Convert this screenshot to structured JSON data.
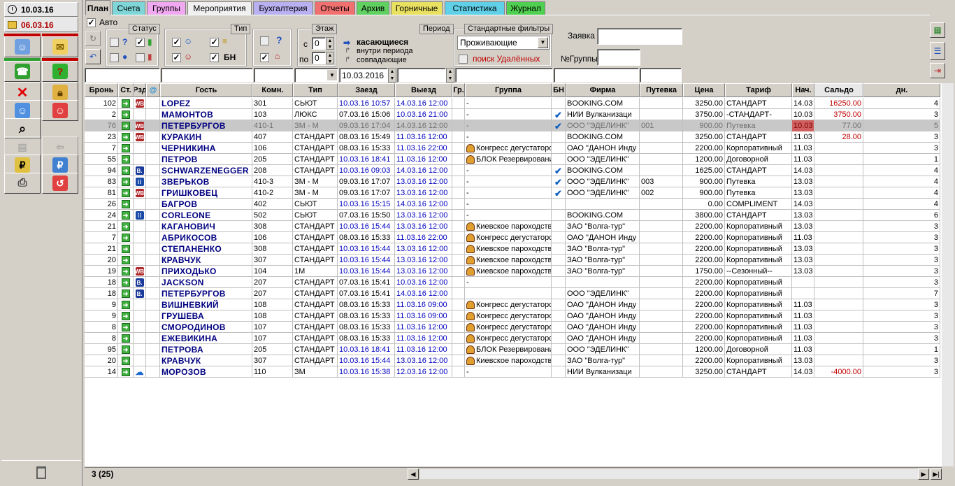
{
  "left_panel": {
    "date1": "10.03.16",
    "date2": "06.03.16"
  },
  "tabs": [
    {
      "label": "План",
      "color": "#d4d0c8",
      "active": true
    },
    {
      "label": "Счета",
      "color": "#7fd6d8"
    },
    {
      "label": "Группы",
      "color": "#f0a8f0"
    },
    {
      "label": "Мероприятия",
      "color": "#f0f0f0"
    },
    {
      "label": "Бухгалтерия",
      "color": "#b8b0f0"
    },
    {
      "label": "Отчеты",
      "color": "#f07070"
    },
    {
      "label": "Архив",
      "color": "#60d060"
    },
    {
      "label": "Горничные",
      "color": "#e8e060"
    },
    {
      "label": "Статистика",
      "color": "#60d0e8"
    },
    {
      "label": "Журнал",
      "color": "#50d050"
    }
  ],
  "toolbar": {
    "auto_label": "Авто",
    "status_label": "Статус",
    "type_label": "Тип",
    "bn_label": "БН",
    "floor_label": "Этаж",
    "from_label": "с",
    "to_label": "по",
    "floor_from": "0",
    "floor_to": "0",
    "period_label": "Период",
    "period_opt1": "касающиеся",
    "period_opt2": "внутри периода",
    "period_opt3": "совпадающие",
    "std_filters_label": "Стандартные фильтры",
    "std_filter_value": "Проживающие",
    "deleted_label": "поиск Удалённых",
    "zayavka_label": "Заявка",
    "group_no_label": "№Группы",
    "date_filter": "10.03.2016"
  },
  "columns": [
    "Бронь",
    "Ст.",
    "Рзд",
    "@",
    "Гость",
    "Комн.",
    "Тип",
    "Заезд",
    "Выезд",
    "Гр.",
    "Группа",
    "БН",
    "Фирма",
    "Путевка",
    "Цена",
    "Тариф",
    "Нач.",
    "Сальдо",
    "дн."
  ],
  "rows": [
    {
      "id": "102",
      "src": "WB",
      "guest": "LOPEZ",
      "room": "301",
      "type": "СЬЮТ",
      "in": "10.03.16 10:57",
      "out": "14.03.16 12:00",
      "grp": false,
      "group": "-",
      "bn": false,
      "firm": "BOOKING.COM",
      "voucher": "",
      "price": "3250.00",
      "tariff": "СТАНДАРТ",
      "start": "14.03",
      "saldo": "16250.00",
      "days": "4",
      "in_blue": true,
      "out_blue": true,
      "saldo_red": true
    },
    {
      "id": "2",
      "src": "",
      "guest": "МАМОНТОВ",
      "room": "103",
      "type": "ЛЮКС",
      "in": "07.03.16 15:06",
      "out": "10.03.16 21:00",
      "grp": false,
      "group": "-",
      "bn": true,
      "firm": "НИИ Вулканизаци",
      "voucher": "",
      "price": "3750.00",
      "tariff": "-СТАНДАРТ-",
      "start": "10.03",
      "saldo": "3750.00",
      "days": "3",
      "in_blue": false,
      "out_blue": true,
      "saldo_red": true
    },
    {
      "id": "76",
      "src": "WB",
      "guest": "ПЕТЕРБУРГОВ",
      "room": "410-1",
      "type": "ЗМ - М",
      "in": "09.03.16 17:04",
      "out": "14.03.16 12:00",
      "grp": false,
      "group": "-",
      "bn": true,
      "firm": "ООО \"ЭДЕЛИНК\"",
      "voucher": "001",
      "price": "900.00",
      "tariff": "Путевка",
      "start": "10.03",
      "saldo": "77.00",
      "days": "5",
      "selected": true,
      "saldo_red": true
    },
    {
      "id": "23",
      "src": "WB",
      "guest": "КУРАКИН",
      "room": "407",
      "type": "СТАНДАРТ",
      "in": "08.03.16 15:49",
      "out": "11.03.16 12:00",
      "grp": false,
      "group": "-",
      "bn": false,
      "firm": "BOOKING.COM",
      "voucher": "",
      "price": "3250.00",
      "tariff": "СТАНДАРТ",
      "start": "11.03",
      "saldo": "28.00",
      "days": "3",
      "in_blue": false,
      "out_blue": true,
      "saldo_red": true
    },
    {
      "id": "7",
      "src": "",
      "guest": "ЧЕРНИКИНА",
      "room": "106",
      "type": "СТАНДАРТ",
      "in": "08.03.16 15:33",
      "out": "11.03.16 22:00",
      "grp": true,
      "group": "Конгресс дегустаторов",
      "bn": false,
      "firm": "ОАО \"ДАНОН Инду",
      "voucher": "",
      "price": "2200.00",
      "tariff": "Корпоративный",
      "start": "11.03",
      "saldo": "",
      "days": "3",
      "out_blue": true
    },
    {
      "id": "55",
      "src": "",
      "guest": "ПЕТРОВ",
      "room": "205",
      "type": "СТАНДАРТ",
      "in": "10.03.16 18:41",
      "out": "11.03.16 12:00",
      "grp": true,
      "group": "БЛОК Резервирований",
      "bn": false,
      "firm": "ООО \"ЭДЕЛИНК\"",
      "voucher": "",
      "price": "1200.00",
      "tariff": "Договорной",
      "start": "11.03",
      "saldo": "",
      "days": "1",
      "in_blue": true,
      "out_blue": true
    },
    {
      "id": "94",
      "src": "B",
      "guest": "SCHWARZENEGGER",
      "room": "208",
      "type": "СТАНДАРТ",
      "in": "10.03.16 09:03",
      "out": "14.03.16 12:00",
      "grp": false,
      "group": "-",
      "bn": true,
      "firm": "BOOKING.COM",
      "voucher": "",
      "price": "1625.00",
      "tariff": "СТАНДАРТ",
      "start": "14.03",
      "saldo": "",
      "days": "4",
      "in_blue": true,
      "out_blue": true
    },
    {
      "id": "83",
      "src": "EX",
      "guest": "ЗВЕРЬКОВ",
      "room": "410-3",
      "type": "ЗМ - М",
      "in": "09.03.16 17:07",
      "out": "13.03.16 12:00",
      "grp": false,
      "group": "-",
      "bn": true,
      "firm": "ООО \"ЭДЕЛИНК\"",
      "voucher": "003",
      "price": "900.00",
      "tariff": "Путевка",
      "start": "13.03",
      "saldo": "",
      "days": "4",
      "out_blue": true
    },
    {
      "id": "81",
      "src": "WB",
      "guest": "ГРИШКОВЕЦ",
      "room": "410-2",
      "type": "ЗМ - М",
      "in": "09.03.16 17:07",
      "out": "13.03.16 12:00",
      "grp": false,
      "group": "-",
      "bn": true,
      "firm": "ООО \"ЭДЕЛИНК\"",
      "voucher": "002",
      "price": "900.00",
      "tariff": "Путевка",
      "start": "13.03",
      "saldo": "",
      "days": "4",
      "out_blue": true
    },
    {
      "id": "26",
      "src": "",
      "guest": "БАГРОВ",
      "room": "402",
      "type": "СЬЮТ",
      "in": "10.03.16 15:15",
      "out": "14.03.16 12:00",
      "grp": false,
      "group": "-",
      "bn": false,
      "firm": "",
      "voucher": "",
      "price": "0.00",
      "tariff": "COMPLIMENT",
      "start": "14.03",
      "saldo": "",
      "days": "4",
      "in_blue": true,
      "out_blue": true
    },
    {
      "id": "24",
      "src": "EX",
      "guest": "CORLEONE",
      "room": "502",
      "type": "СЬЮТ",
      "in": "07.03.16 15:50",
      "out": "13.03.16 12:00",
      "grp": false,
      "group": "-",
      "bn": false,
      "firm": "BOOKING.COM",
      "voucher": "",
      "price": "3800.00",
      "tariff": "СТАНДАРТ",
      "start": "13.03",
      "saldo": "",
      "days": "6",
      "out_blue": true
    },
    {
      "id": "21",
      "src": "",
      "guest": "КАГАНОВИЧ",
      "room": "308",
      "type": "СТАНДАРТ",
      "in": "10.03.16 15:44",
      "out": "13.03.16 12:00",
      "grp": true,
      "group": "Киевское пароходство",
      "bn": false,
      "firm": "ЗАО \"Волга-тур\"",
      "voucher": "",
      "price": "2200.00",
      "tariff": "Корпоративный",
      "start": "13.03",
      "saldo": "",
      "days": "3",
      "in_blue": true,
      "out_blue": true
    },
    {
      "id": "7",
      "src": "",
      "guest": "АБРИКОСОВ",
      "room": "106",
      "type": "СТАНДАРТ",
      "in": "08.03.16 15:33",
      "out": "11.03.16 22:00",
      "grp": true,
      "group": "Конгресс дегустаторов",
      "bn": false,
      "firm": "ОАО \"ДАНОН Инду",
      "voucher": "",
      "price": "2200.00",
      "tariff": "Корпоративный",
      "start": "11.03",
      "saldo": "",
      "days": "3",
      "out_blue": true
    },
    {
      "id": "21",
      "src": "",
      "guest": "СТЕПАНЕНКО",
      "room": "308",
      "type": "СТАНДАРТ",
      "in": "10.03.16 15:44",
      "out": "13.03.16 12:00",
      "grp": true,
      "group": "Киевское пароходство",
      "bn": false,
      "firm": "ЗАО \"Волга-тур\"",
      "voucher": "",
      "price": "2200.00",
      "tariff": "Корпоративный",
      "start": "13.03",
      "saldo": "",
      "days": "3",
      "in_blue": true,
      "out_blue": true
    },
    {
      "id": "20",
      "src": "",
      "guest": "КРАВЧУК",
      "room": "307",
      "type": "СТАНДАРТ",
      "in": "10.03.16 15:44",
      "out": "13.03.16 12:00",
      "grp": true,
      "group": "Киевское пароходство",
      "bn": false,
      "firm": "ЗАО \"Волга-тур\"",
      "voucher": "",
      "price": "2200.00",
      "tariff": "Корпоративный",
      "start": "13.03",
      "saldo": "",
      "days": "3",
      "in_blue": true,
      "out_blue": true
    },
    {
      "id": "19",
      "src": "WB",
      "guest": "ПРИХОДЬКО",
      "room": "104",
      "type": "1М",
      "in": "10.03.16 15:44",
      "out": "13.03.16 12:00",
      "grp": true,
      "group": "Киевское пароходство",
      "bn": false,
      "firm": "ЗАО \"Волга-тур\"",
      "voucher": "",
      "price": "1750.00",
      "tariff": "--Сезонный--",
      "start": "13.03",
      "saldo": "",
      "days": "3",
      "in_blue": true,
      "out_blue": true
    },
    {
      "id": "18",
      "src": "B",
      "guest": "JACKSON",
      "room": "207",
      "type": "СТАНДАРТ",
      "in": "07.03.16 15:41",
      "out": "10.03.16 12:00",
      "grp": false,
      "group": "-",
      "bn": false,
      "firm": "",
      "voucher": "",
      "price": "2200.00",
      "tariff": "Корпоративный",
      "start": "",
      "saldo": "",
      "days": "3",
      "out_blue": true
    },
    {
      "id": "18",
      "src": "B",
      "guest": "ПЕТЕРБУРГОВ",
      "room": "207",
      "type": "СТАНДАРТ",
      "in": "07.03.16 15:41",
      "out": "14.03.16 12:00",
      "grp": false,
      "group": "",
      "bn": false,
      "firm": "ООО \"ЭДЕЛИНК\"",
      "voucher": "",
      "price": "2200.00",
      "tariff": "Корпоративный",
      "start": "",
      "saldo": "",
      "days": "7",
      "out_blue": true
    },
    {
      "id": "9",
      "src": "",
      "guest": "ВИШНЕВКИЙ",
      "room": "108",
      "type": "СТАНДАРТ",
      "in": "08.03.16 15:33",
      "out": "11.03.16 09:00",
      "grp": true,
      "group": "Конгресс дегустаторов",
      "bn": false,
      "firm": "ОАО \"ДАНОН Инду",
      "voucher": "",
      "price": "2200.00",
      "tariff": "Корпоративный",
      "start": "11.03",
      "saldo": "",
      "days": "3",
      "out_blue": true
    },
    {
      "id": "9",
      "src": "",
      "guest": "ГРУШЕВА",
      "room": "108",
      "type": "СТАНДАРТ",
      "in": "08.03.16 15:33",
      "out": "11.03.16 09:00",
      "grp": true,
      "group": "Конгресс дегустаторов",
      "bn": false,
      "firm": "ОАО \"ДАНОН Инду",
      "voucher": "",
      "price": "2200.00",
      "tariff": "Корпоративный",
      "start": "11.03",
      "saldo": "",
      "days": "3",
      "out_blue": true
    },
    {
      "id": "8",
      "src": "",
      "guest": "СМОРОДИНОВ",
      "room": "107",
      "type": "СТАНДАРТ",
      "in": "08.03.16 15:33",
      "out": "11.03.16 12:00",
      "grp": true,
      "group": "Конгресс дегустаторов",
      "bn": false,
      "firm": "ОАО \"ДАНОН Инду",
      "voucher": "",
      "price": "2200.00",
      "tariff": "Корпоративный",
      "start": "11.03",
      "saldo": "",
      "days": "3",
      "out_blue": true
    },
    {
      "id": "8",
      "src": "",
      "guest": "ЕЖЕВИКИНА",
      "room": "107",
      "type": "СТАНДАРТ",
      "in": "08.03.16 15:33",
      "out": "11.03.16 12:00",
      "grp": true,
      "group": "Конгресс дегустаторов",
      "bn": false,
      "firm": "ОАО \"ДАНОН Инду",
      "voucher": "",
      "price": "2200.00",
      "tariff": "Корпоративный",
      "start": "11.03",
      "saldo": "",
      "days": "3",
      "out_blue": true
    },
    {
      "id": "95",
      "src": "",
      "guest": "ПЕТРОВА",
      "room": "205",
      "type": "СТАНДАРТ",
      "in": "10.03.16 18:41",
      "out": "11.03.16 12:00",
      "grp": true,
      "group": "БЛОК Резервирований",
      "bn": false,
      "firm": "ООО \"ЭДЕЛИНК\"",
      "voucher": "",
      "price": "1200.00",
      "tariff": "Договорной",
      "start": "11.03",
      "saldo": "",
      "days": "1",
      "in_blue": true,
      "out_blue": true
    },
    {
      "id": "20",
      "src": "",
      "guest": "КРАВЧУК",
      "room": "307",
      "type": "СТАНДАРТ",
      "in": "10.03.16 15:44",
      "out": "13.03.16 12:00",
      "grp": true,
      "group": "Киевское пароходство",
      "bn": false,
      "firm": "ЗАО \"Волга-тур\"",
      "voucher": "",
      "price": "2200.00",
      "tariff": "Корпоративный",
      "start": "13.03",
      "saldo": "",
      "days": "3",
      "in_blue": true,
      "out_blue": true
    },
    {
      "id": "14",
      "src": "cloud",
      "guest": "МОРОЗОВ",
      "room": "110",
      "type": "ЗМ",
      "in": "10.03.16 15:38",
      "out": "12.03.16 12:00",
      "grp": false,
      "group": "-",
      "bn": false,
      "firm": "НИИ Вулканизаци",
      "voucher": "",
      "price": "3250.00",
      "tariff": "СТАНДАРТ",
      "start": "14.03",
      "saldo": "-4000.00",
      "days": "3",
      "in_blue": true,
      "out_blue": true,
      "saldo_red": true
    }
  ],
  "status": {
    "count": "3 (25)"
  }
}
